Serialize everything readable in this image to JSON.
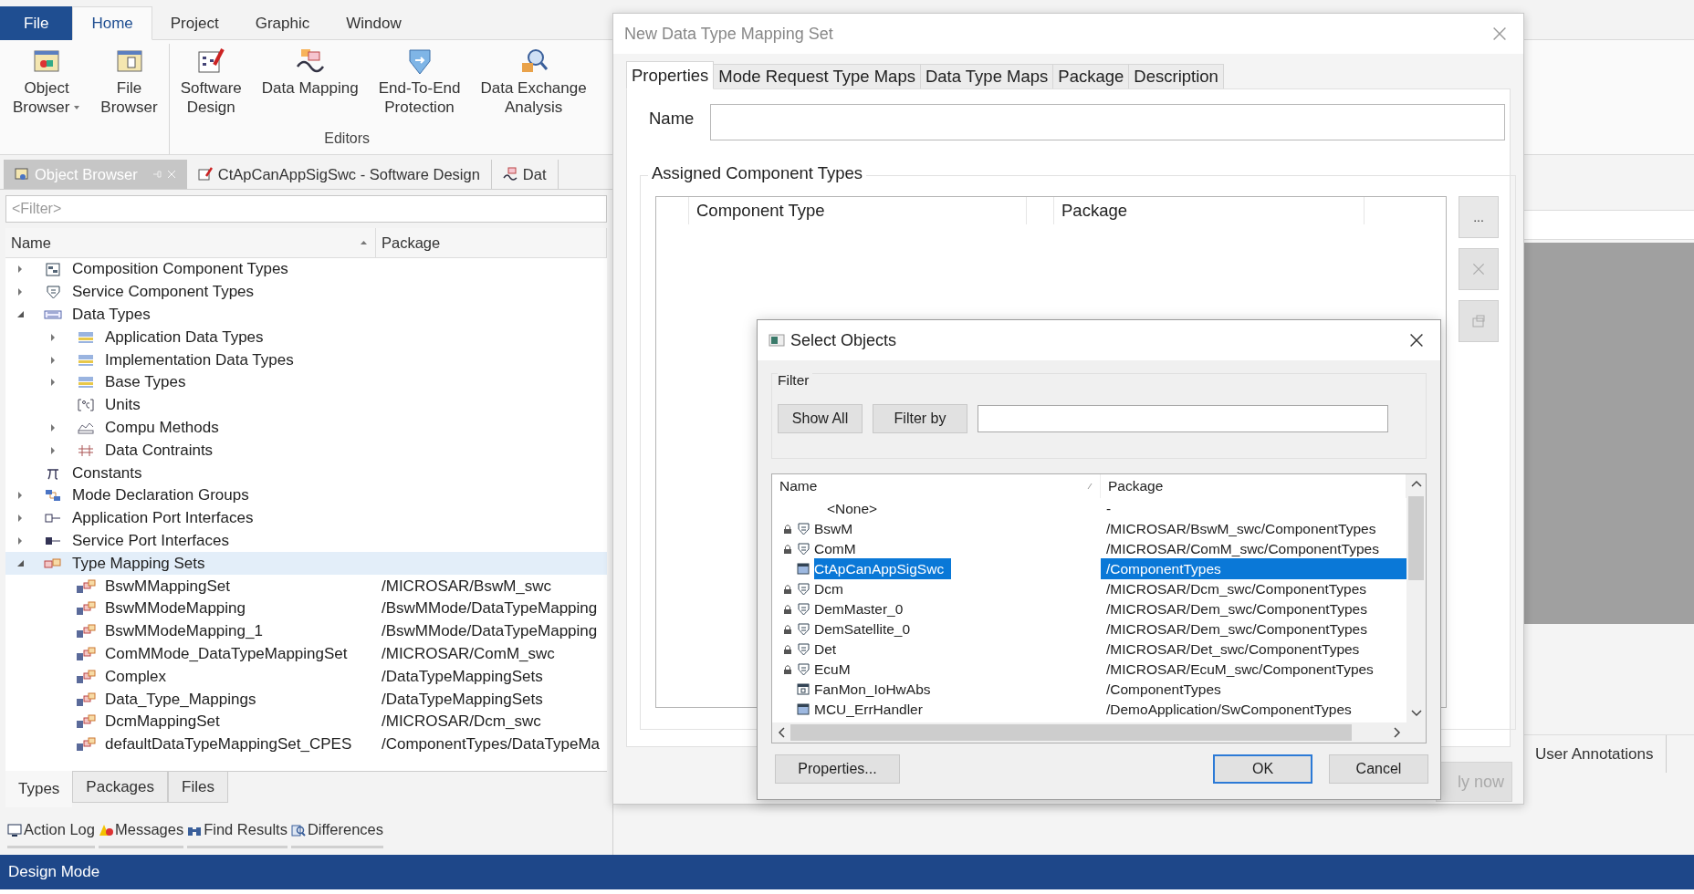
{
  "ribbon": {
    "tabs": [
      {
        "label": "File",
        "kind": "file",
        "selected": false
      },
      {
        "label": "Home",
        "kind": "tab",
        "selected": true
      },
      {
        "label": "Project",
        "kind": "tab",
        "selected": false
      },
      {
        "label": "Graphic",
        "kind": "tab",
        "selected": false
      },
      {
        "label": "Window",
        "kind": "tab",
        "selected": false
      }
    ],
    "groups": [
      {
        "buttons": [
          {
            "lines": [
              "Object",
              "Browser"
            ],
            "kind": "object-browser",
            "dropdown": true
          },
          {
            "lines": [
              "File",
              "Browser"
            ],
            "kind": "file-browser",
            "dropdown": false
          }
        ]
      },
      {
        "label": "Editors",
        "buttons": [
          {
            "lines": [
              "Software",
              "Design"
            ],
            "kind": "software-design",
            "dropdown": false
          },
          {
            "lines": [
              "Data Mapping"
            ],
            "kind": "data-mapping",
            "dropdown": false
          },
          {
            "lines": [
              "End-To-End",
              "Protection"
            ],
            "kind": "e2e",
            "dropdown": false
          },
          {
            "lines": [
              "Data Exchange",
              "Analysis"
            ],
            "kind": "dea",
            "dropdown": false
          }
        ]
      }
    ]
  },
  "doc_tabs": [
    {
      "label": "Object Browser",
      "kind": "browser",
      "selected": true
    },
    {
      "label": "CtApCanAppSigSwc - Software Design",
      "kind": "design",
      "selected": false
    },
    {
      "label": "Dat",
      "kind": "mapping",
      "selected": false
    }
  ],
  "filter": {
    "placeholder": "<Filter>"
  },
  "columns": [
    "Name",
    "Package"
  ],
  "tree": [
    {
      "label": "Composition Component Types",
      "kind": "composition",
      "expanded": false,
      "selected": false
    },
    {
      "label": "Service Component Types",
      "kind": "service",
      "expanded": false,
      "selected": false
    },
    {
      "label": "Data Types",
      "kind": "datatypes",
      "expanded": true,
      "selected": false,
      "children": [
        {
          "label": "Application Data Types",
          "kind": "type",
          "expanded": false,
          "selected": false
        },
        {
          "label": "Implementation Data Types",
          "kind": "type",
          "expanded": false,
          "selected": false
        },
        {
          "label": "Base Types",
          "kind": "type",
          "expanded": false,
          "selected": false
        },
        {
          "label": "Units",
          "kind": "units",
          "selected": false
        },
        {
          "label": "Compu Methods",
          "kind": "compu",
          "expanded": false,
          "selected": false
        },
        {
          "label": "Data Contraints",
          "kind": "constraints",
          "expanded": false,
          "selected": false
        }
      ]
    },
    {
      "label": "Constants",
      "kind": "constants",
      "selected": false
    },
    {
      "label": "Mode Declaration Groups",
      "kind": "mode",
      "expanded": false,
      "selected": false
    },
    {
      "label": "Application Port Interfaces",
      "kind": "app-port",
      "expanded": false,
      "selected": false
    },
    {
      "label": "Service Port Interfaces",
      "kind": "service-port",
      "expanded": false,
      "selected": false
    },
    {
      "label": "Type Mapping Sets",
      "kind": "mapping",
      "expanded": true,
      "selected": true,
      "children": [
        {
          "label": "BswMMappingSet",
          "package": "/MICROSAR/BswM_swc",
          "kind": "mapping-set",
          "selected": false
        },
        {
          "label": "BswMModeMapping",
          "package": "/BswMMode/DataTypeMapping",
          "kind": "mapping-set",
          "selected": false
        },
        {
          "label": "BswMModeMapping_1",
          "package": "/BswMMode/DataTypeMapping",
          "kind": "mapping-set",
          "selected": false
        },
        {
          "label": "ComMMode_DataTypeMappingSet",
          "package": "/MICROSAR/ComM_swc",
          "kind": "mapping-set",
          "selected": false
        },
        {
          "label": "Complex",
          "package": "/DataTypeMappingSets",
          "kind": "mapping-set",
          "selected": false
        },
        {
          "label": "Data_Type_Mappings",
          "package": "/DataTypeMappingSets",
          "kind": "mapping-set",
          "selected": false
        },
        {
          "label": "DcmMappingSet",
          "package": "/MICROSAR/Dcm_swc",
          "kind": "mapping-set",
          "selected": false
        },
        {
          "label": "defaultDataTypeMappingSet_CPES",
          "package": "/ComponentTypes/DataTypeMa",
          "kind": "mapping-set",
          "selected": false
        }
      ]
    }
  ],
  "bottom_tabs": [
    {
      "label": "Types",
      "selected": true
    },
    {
      "label": "Packages",
      "selected": false
    },
    {
      "label": "Files",
      "selected": false
    }
  ],
  "tool_windows": [
    {
      "label": "Action Log",
      "kind": "log"
    },
    {
      "label": "Messages",
      "kind": "messages"
    },
    {
      "label": "Find Results",
      "kind": "find"
    },
    {
      "label": "Differences",
      "kind": "diff"
    }
  ],
  "status_bar": "Design Mode",
  "right_panel": {
    "tabs": [
      "User Annotations"
    ]
  },
  "mapping_dialog": {
    "title": "New Data Type Mapping Set",
    "tabs": [
      {
        "label": "Properties",
        "selected": true
      },
      {
        "label": "Mode Request Type Maps",
        "selected": false
      },
      {
        "label": "Data Type Maps",
        "selected": false
      },
      {
        "label": "Package",
        "selected": false
      },
      {
        "label": "Description",
        "selected": false
      }
    ],
    "name_label": "Name",
    "group_title": "Assigned Component Types",
    "columns": [
      "Component Type",
      "Package"
    ],
    "side_buttons": [
      {
        "kind": "text",
        "label": "...",
        "disabled": false
      },
      {
        "kind": "delete",
        "disabled": true
      },
      {
        "kind": "properties",
        "disabled": true
      }
    ],
    "apply_button": {
      "label": "ly now",
      "disabled": true
    }
  },
  "select_dialog": {
    "title": "Select Objects",
    "filter_label": "Filter",
    "filter_buttons": [
      "Show All",
      "Filter by"
    ],
    "columns": [
      "Name",
      "Package"
    ],
    "rows": [
      {
        "name": "<None>",
        "package": "-",
        "kind": "none",
        "locked": false,
        "selected": false
      },
      {
        "name": "BswM",
        "package": "/MICROSAR/BswM_swc/ComponentTypes",
        "kind": "service",
        "locked": true,
        "selected": false
      },
      {
        "name": "ComM",
        "package": "/MICROSAR/ComM_swc/ComponentTypes",
        "kind": "service",
        "locked": true,
        "selected": false
      },
      {
        "name": "CtApCanAppSigSwc",
        "package": "/ComponentTypes",
        "kind": "application",
        "locked": false,
        "selected": true
      },
      {
        "name": "Dcm",
        "package": "/MICROSAR/Dcm_swc/ComponentTypes",
        "kind": "service",
        "locked": true,
        "selected": false
      },
      {
        "name": "DemMaster_0",
        "package": "/MICROSAR/Dem_swc/ComponentTypes",
        "kind": "service",
        "locked": true,
        "selected": false
      },
      {
        "name": "DemSatellite_0",
        "package": "/MICROSAR/Dem_swc/ComponentTypes",
        "kind": "service",
        "locked": true,
        "selected": false
      },
      {
        "name": "Det",
        "package": "/MICROSAR/Det_swc/ComponentTypes",
        "kind": "service",
        "locked": true,
        "selected": false
      },
      {
        "name": "EcuM",
        "package": "/MICROSAR/EcuM_swc/ComponentTypes",
        "kind": "service",
        "locked": true,
        "selected": false
      },
      {
        "name": "FanMon_IoHwAbs",
        "package": "/ComponentTypes",
        "kind": "io",
        "locked": false,
        "selected": false
      },
      {
        "name": "MCU_ErrHandler",
        "package": "/DemoApplication/SwComponentTypes",
        "kind": "application",
        "locked": false,
        "selected": false
      }
    ],
    "footer_buttons": [
      {
        "label": "Properties...",
        "default": false
      },
      {
        "label": "OK",
        "default": true
      },
      {
        "label": "Cancel",
        "default": false
      }
    ]
  }
}
